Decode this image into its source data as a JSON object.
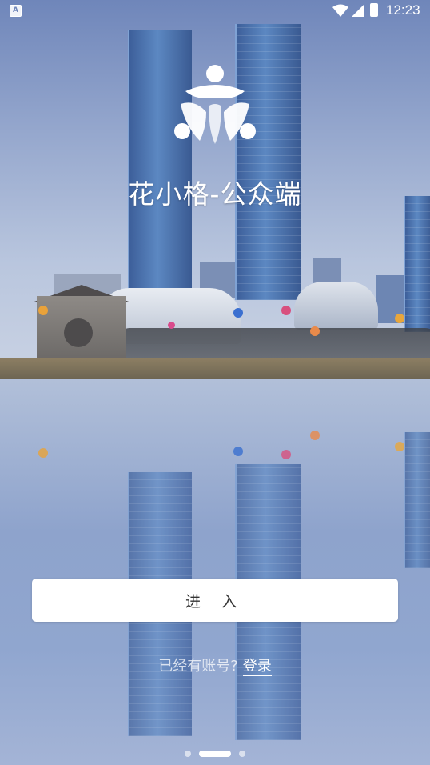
{
  "status_bar": {
    "time": "12:23",
    "left_icon": "A",
    "icons": [
      "wifi-icon",
      "signal-icon",
      "battery-icon"
    ]
  },
  "app": {
    "title": "花小格-公众端",
    "logo": "flower-people-logo"
  },
  "actions": {
    "enter_label": "进 入",
    "login_prompt": "已经有账号?",
    "login_link": "登录"
  },
  "pager": {
    "pages": 3,
    "active_index": 1
  },
  "colors": {
    "button_bg": "#ffffff",
    "text_on_bg": "#ffffff",
    "sky_top": "#6f86ba"
  }
}
